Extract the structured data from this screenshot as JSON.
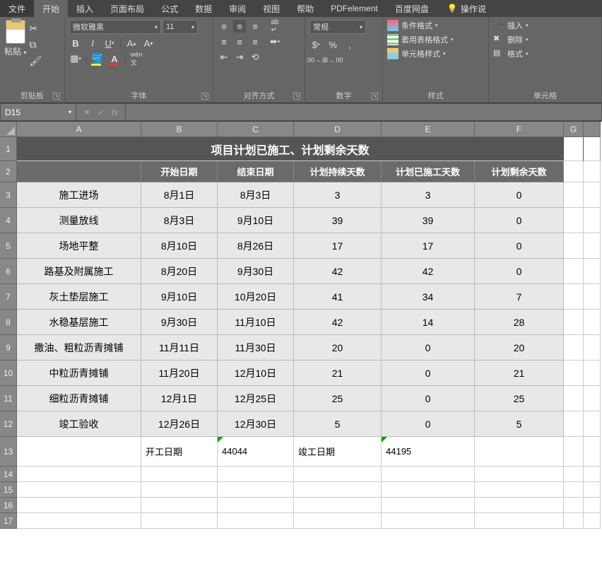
{
  "menubar": {
    "tabs": [
      "文件",
      "开始",
      "插入",
      "页面布局",
      "公式",
      "数据",
      "审阅",
      "视图",
      "帮助",
      "PDFelement",
      "百度网盘"
    ],
    "active_index": 1,
    "tell_me": "操作说"
  },
  "ribbon": {
    "clipboard": {
      "paste": "粘贴",
      "label": "剪贴板"
    },
    "font": {
      "name": "微软雅黑",
      "size": "11",
      "label": "字体"
    },
    "align": {
      "label": "对齐方式"
    },
    "number": {
      "format": "常规",
      "label": "数字"
    },
    "styles": {
      "cond": "条件格式",
      "table": "套用表格格式",
      "cell": "单元格样式",
      "label": "样式"
    },
    "cells": {
      "insert": "插入",
      "delete": "删除",
      "format": "格式",
      "label": "单元格"
    }
  },
  "fbar": {
    "name": "D15",
    "fx": "fx"
  },
  "sheet": {
    "cols": [
      "A",
      "B",
      "C",
      "D",
      "E",
      "F",
      "G",
      ""
    ],
    "title": "项目计划已施工、计划剩余天数",
    "headers": [
      "",
      "开始日期",
      "结束日期",
      "计划持续天数",
      "计划已施工天数",
      "计划剩余天数"
    ],
    "rows": [
      {
        "a": "施工进场",
        "b": "8月1日",
        "c": "8月3日",
        "d": "3",
        "e": "3",
        "f": "0"
      },
      {
        "a": "测量放线",
        "b": "8月3日",
        "c": "9月10日",
        "d": "39",
        "e": "39",
        "f": "0"
      },
      {
        "a": "场地平整",
        "b": "8月10日",
        "c": "8月26日",
        "d": "17",
        "e": "17",
        "f": "0"
      },
      {
        "a": "路基及附属施工",
        "b": "8月20日",
        "c": "9月30日",
        "d": "42",
        "e": "42",
        "f": "0"
      },
      {
        "a": "灰土垫层施工",
        "b": "9月10日",
        "c": "10月20日",
        "d": "41",
        "e": "34",
        "f": "7"
      },
      {
        "a": "水稳基层施工",
        "b": "9月30日",
        "c": "11月10日",
        "d": "42",
        "e": "14",
        "f": "28"
      },
      {
        "a": "撒油、粗粒沥青摊铺",
        "b": "11月11日",
        "c": "11月30日",
        "d": "20",
        "e": "0",
        "f": "20"
      },
      {
        "a": "中粒沥青摊铺",
        "b": "11月20日",
        "c": "12月10日",
        "d": "21",
        "e": "0",
        "f": "21"
      },
      {
        "a": "细粒沥青摊铺",
        "b": "12月1日",
        "c": "12月25日",
        "d": "25",
        "e": "0",
        "f": "25"
      },
      {
        "a": "竣工验收",
        "b": "12月26日",
        "c": "12月30日",
        "d": "5",
        "e": "0",
        "f": "5"
      }
    ],
    "footer": {
      "b": "开工日期",
      "c": "44044",
      "d": "竣工日期",
      "e": "44195"
    },
    "rownums": [
      1,
      2,
      3,
      4,
      5,
      6,
      7,
      8,
      9,
      10,
      11,
      12,
      13,
      14,
      15,
      16,
      17
    ]
  }
}
